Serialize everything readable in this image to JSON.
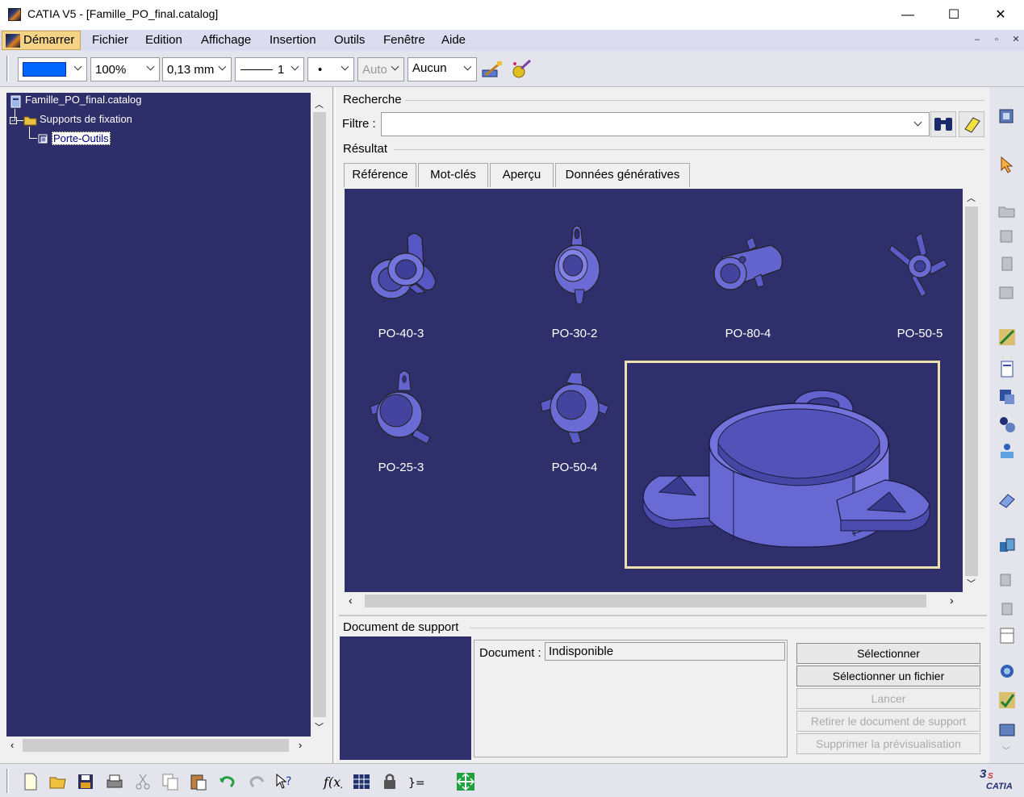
{
  "window": {
    "title": "CATIA V5 - [Famille_PO_final.catalog]",
    "minimize": "—",
    "maximize": "☐",
    "close": "✕"
  },
  "menu": {
    "demarrer": "Démarrer",
    "items": [
      "Fichier",
      "Edition",
      "Affichage",
      "Insertion",
      "Outils",
      "Fenêtre",
      "Aide"
    ]
  },
  "toolbar": {
    "color_value": "#0066ff",
    "zoom": "100%",
    "thickness": "0,13 mm",
    "linetype": "1",
    "point": "•",
    "auto": "Auto",
    "layer": "Aucun"
  },
  "tree": {
    "root": "Famille_PO_final.catalog",
    "chapter": "Supports de fixation",
    "family": "Porte-Outils"
  },
  "search": {
    "section": "Recherche",
    "filter_label": "Filtre :",
    "filter_value": ""
  },
  "result": {
    "section": "Résultat",
    "tabs": [
      "Référence",
      "Mot-clés",
      "Aperçu",
      "Données génératives"
    ],
    "items": [
      "PO-40-3",
      "PO-30-2",
      "PO-80-4",
      "PO-50-5",
      "PO-25-3",
      "PO-50-4"
    ]
  },
  "support": {
    "section": "Document de support",
    "document_label": "Document :",
    "document_value": "Indisponible",
    "buttons": [
      {
        "label": "Sélectionner",
        "enabled": true
      },
      {
        "label": "Sélectionner un fichier",
        "enabled": true
      },
      {
        "label": "Lancer",
        "enabled": false
      },
      {
        "label": "Retirer le document de support",
        "enabled": false
      },
      {
        "label": "Supprimer la prévisualisation",
        "enabled": false
      }
    ]
  },
  "brand": {
    "logo_text": "CATIA"
  },
  "colors": {
    "tree_bg": "#2e2e6a",
    "gallery_bg": "#2f2f6b",
    "part": "#6b6bd6",
    "selection": "#f0e0b0",
    "menu_bg": "#dcdcf0"
  }
}
